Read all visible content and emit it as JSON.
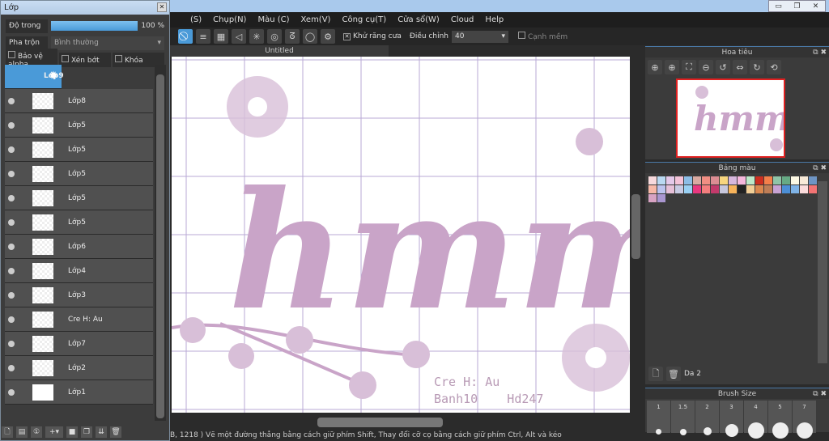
{
  "window": {
    "minimize": "▭",
    "restore": "❐",
    "close": "✕"
  },
  "menu": [
    "(S)",
    "Chụp(N)",
    "Màu (C)",
    "Xem(V)",
    "Công cụ(T)",
    "Cửa sổ(W)",
    "Cloud",
    "Help"
  ],
  "toolbar": {
    "antialias_label": "Khử răng cưa",
    "adjust_label": "Điều chỉnh",
    "adjust_value": "40",
    "soft_edge_label": "Cạnh mềm",
    "antialias_checked": true,
    "soft_edge_checked": false
  },
  "document": {
    "tab": "Untitled"
  },
  "canvas": {
    "art_text": "hmm",
    "credit1": "Cre H: Au",
    "credit2": "Banh10    Hd247",
    "accent": "#c9a4c8"
  },
  "status": "B, 1218 )  Vẽ một đường thẳng bằng cách giữ phím Shift, Thay đổi cỡ cọ bằng cách giữ phím Ctrl, Alt và kéo",
  "layer_panel": {
    "title": "Lớp",
    "opacity_label": "Độ trong",
    "opacity_value": "100 %",
    "opacity": 100,
    "blend_label": "Pha trộn",
    "blend_value": "Bình thường",
    "protect_alpha": "Bảo vệ alpha",
    "clip": "Xén bớt",
    "lock": "Khóa",
    "layers": [
      {
        "name": "Lớp9",
        "selected": true
      },
      {
        "name": "Lớp8"
      },
      {
        "name": "Lớp5"
      },
      {
        "name": "Lớp5"
      },
      {
        "name": "Lớp5"
      },
      {
        "name": "Lớp5"
      },
      {
        "name": "Lớp5"
      },
      {
        "name": "Lớp6"
      },
      {
        "name": "Lớp4"
      },
      {
        "name": "Lớp3"
      },
      {
        "name": "Cre H: Au"
      },
      {
        "name": "Lớp7"
      },
      {
        "name": "Lớp2"
      },
      {
        "name": "Lớp1"
      }
    ]
  },
  "navigator": {
    "title": "Hoa tiêu"
  },
  "palette": {
    "title": "Bảng màu",
    "name": "Da 2",
    "colors": [
      "#f7d9dc",
      "#b9d9f2",
      "#e4c9ea",
      "#f4c3d9",
      "#8cbde6",
      "#d9a9a1",
      "#f08e83",
      "#dc8d93",
      "#f7d57e",
      "#d7b7dd",
      "#f5b7dc",
      "#bde9c9",
      "#cc2f20",
      "#f47f4a",
      "#8fc4a7",
      "#66aa84",
      "#fdf9e4",
      "#f8ead8",
      "#6e95c4",
      "#f7b8a7",
      "#bcc3ee",
      "#e6c0d8",
      "#c8cbe4",
      "#99d0f3",
      "#e8387f",
      "#f37e7e",
      "#c33a6b",
      "#c7c7dc",
      "#f7b35a",
      "#222222",
      "#f2cf97",
      "#d9874e",
      "#be7d56",
      "#c7a2d3",
      "#4c8fd6",
      "#7fb3e6",
      "#fbdcdc",
      "#f37474",
      "#d8a3c3",
      "#a996d0"
    ]
  },
  "brush_size": {
    "title": "Brush Size",
    "sizes": [
      "1",
      "1.5",
      "2",
      "3",
      "4",
      "5",
      "7"
    ]
  }
}
